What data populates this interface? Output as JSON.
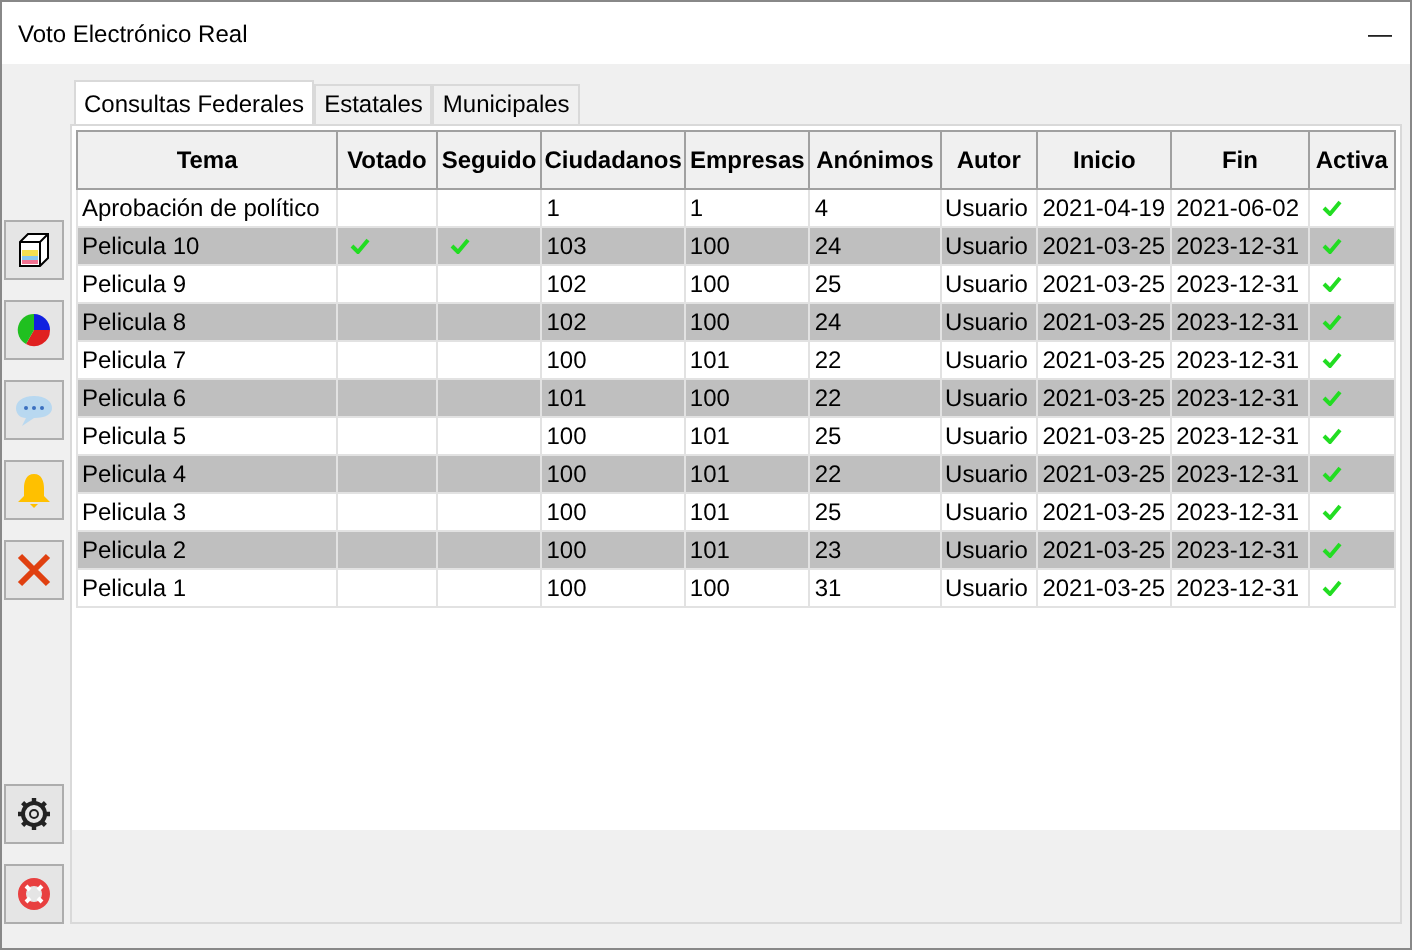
{
  "window": {
    "title": "Voto Electrónico Real",
    "minimize": "—"
  },
  "tabs": [
    {
      "label": "Consultas Federales",
      "selected": true
    },
    {
      "label": "Estatales",
      "selected": false
    },
    {
      "label": "Municipales",
      "selected": false
    }
  ],
  "table": {
    "columns": [
      "Tema",
      "Votado",
      "Seguido",
      "Ciudadanos",
      "Empresas",
      "Anónimos",
      "Autor",
      "Inicio",
      "Fin",
      "Activa"
    ],
    "rows": [
      {
        "tema": "Aprobación de político",
        "votado": false,
        "seguido": false,
        "ciudadanos": "1",
        "empresas": "1",
        "anonimos": "4",
        "autor": "Usuario",
        "inicio": "2021-04-19",
        "fin": "2021-06-02",
        "activa": true
      },
      {
        "tema": "Pelicula 10",
        "votado": true,
        "seguido": true,
        "ciudadanos": "103",
        "empresas": "100",
        "anonimos": "24",
        "autor": "Usuario",
        "inicio": "2021-03-25",
        "fin": "2023-12-31",
        "activa": true
      },
      {
        "tema": "Pelicula 9",
        "votado": false,
        "seguido": false,
        "ciudadanos": "102",
        "empresas": "100",
        "anonimos": "25",
        "autor": "Usuario",
        "inicio": "2021-03-25",
        "fin": "2023-12-31",
        "activa": true
      },
      {
        "tema": "Pelicula 8",
        "votado": false,
        "seguido": false,
        "ciudadanos": "102",
        "empresas": "100",
        "anonimos": "24",
        "autor": "Usuario",
        "inicio": "2021-03-25",
        "fin": "2023-12-31",
        "activa": true
      },
      {
        "tema": "Pelicula 7",
        "votado": false,
        "seguido": false,
        "ciudadanos": "100",
        "empresas": "101",
        "anonimos": "22",
        "autor": "Usuario",
        "inicio": "2021-03-25",
        "fin": "2023-12-31",
        "activa": true
      },
      {
        "tema": "Pelicula 6",
        "votado": false,
        "seguido": false,
        "ciudadanos": "101",
        "empresas": "100",
        "anonimos": "22",
        "autor": "Usuario",
        "inicio": "2021-03-25",
        "fin": "2023-12-31",
        "activa": true
      },
      {
        "tema": "Pelicula 5",
        "votado": false,
        "seguido": false,
        "ciudadanos": "100",
        "empresas": "101",
        "anonimos": "25",
        "autor": "Usuario",
        "inicio": "2021-03-25",
        "fin": "2023-12-31",
        "activa": true
      },
      {
        "tema": "Pelicula 4",
        "votado": false,
        "seguido": false,
        "ciudadanos": "100",
        "empresas": "101",
        "anonimos": "22",
        "autor": "Usuario",
        "inicio": "2021-03-25",
        "fin": "2023-12-31",
        "activa": true
      },
      {
        "tema": "Pelicula 3",
        "votado": false,
        "seguido": false,
        "ciudadanos": "100",
        "empresas": "101",
        "anonimos": "25",
        "autor": "Usuario",
        "inicio": "2021-03-25",
        "fin": "2023-12-31",
        "activa": true
      },
      {
        "tema": "Pelicula 2",
        "votado": false,
        "seguido": false,
        "ciudadanos": "100",
        "empresas": "101",
        "anonimos": "23",
        "autor": "Usuario",
        "inicio": "2021-03-25",
        "fin": "2023-12-31",
        "activa": true
      },
      {
        "tema": "Pelicula 1",
        "votado": false,
        "seguido": false,
        "ciudadanos": "100",
        "empresas": "100",
        "anonimos": "31",
        "autor": "Usuario",
        "inicio": "2021-03-25",
        "fin": "2023-12-31",
        "activa": true
      }
    ]
  }
}
